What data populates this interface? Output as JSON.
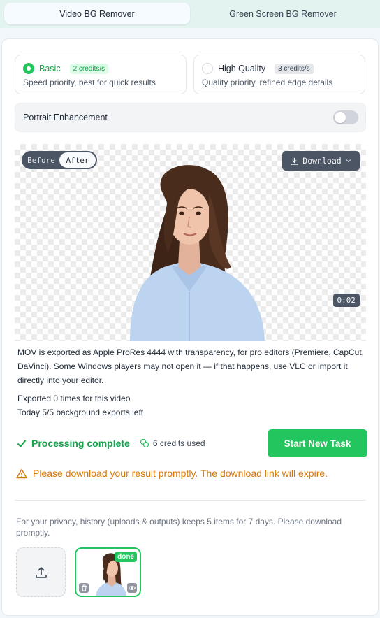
{
  "tabs": [
    {
      "label": "Video BG Remover",
      "active": true
    },
    {
      "label": "Green Screen BG Remover",
      "active": false
    }
  ],
  "modes": [
    {
      "name": "Basic",
      "credits": "2 credits/s",
      "description": "Speed priority, best for quick results",
      "selected": true
    },
    {
      "name": "High Quality",
      "credits": "3 credits/s",
      "description": "Quality priority, refined edge details",
      "selected": false
    }
  ],
  "portrait": {
    "label": "Portrait Enhancement",
    "enabled": false
  },
  "preview": {
    "before_label": "Before",
    "after_label": "After",
    "download_label": "Download",
    "duration": "0:02"
  },
  "info_text": "MOV is exported as Apple ProRes 4444 with transparency, for pro editors (Premiere, CapCut, DaVinci). Some Windows players may not open it — if that happens, use VLC or import it directly into your editor.",
  "exports": {
    "count_text": "Exported 0 times for this video",
    "remaining_text": "Today 5/5 background exports left"
  },
  "status": {
    "complete_label": "Processing complete",
    "credits_used": "6 credits used",
    "start_button": "Start New Task"
  },
  "warning": "Please download your result promptly. The download link will expire.",
  "history": {
    "privacy_text": "For your privacy, history (uploads & outputs) keeps 5 items for 7 days. Please download promptly.",
    "items": [
      {
        "status": "done"
      }
    ]
  },
  "colors": {
    "accent": "#22c55e",
    "warning": "#d97706",
    "dark_control": "#4b5563"
  }
}
